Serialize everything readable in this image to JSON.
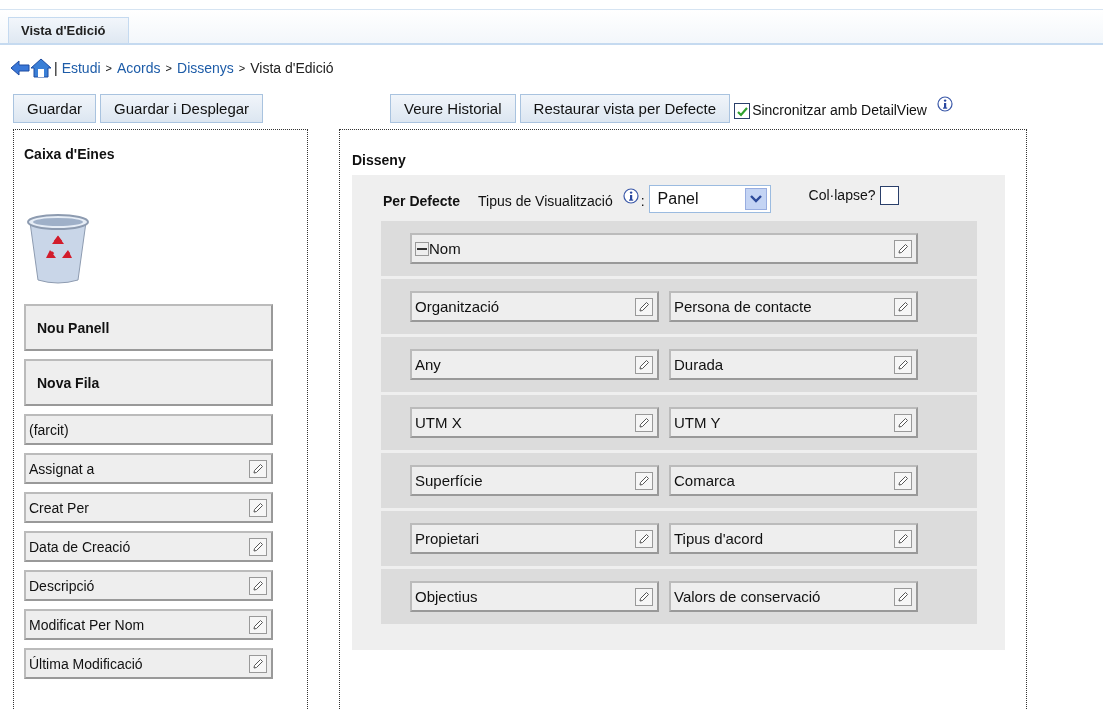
{
  "tab": {
    "label": "Vista d'Edició",
    "selected": true
  },
  "breadcrumb": {
    "divider": "|",
    "links": [
      "Estudi",
      "Acords",
      "Dissenys"
    ],
    "separator": ">",
    "current": "Vista d'Edició"
  },
  "left_buttons": [
    "Guardar",
    "Guardar i Desplegar"
  ],
  "right_buttons": [
    "Veure Historial",
    "Restaurar vista per Defecte"
  ],
  "sync": {
    "label": "Sincronitzar amb DetailView",
    "checked": true
  },
  "toolbox": {
    "title": "Caixa d'Eines",
    "items": [
      {
        "kind": "panel",
        "label": "Nou Panell"
      },
      {
        "kind": "row",
        "label": "Nova Fila"
      },
      {
        "kind": "filler",
        "label": "(farcit)"
      },
      {
        "kind": "field",
        "label": "Assignat a"
      },
      {
        "kind": "field",
        "label": "Creat Per"
      },
      {
        "kind": "field",
        "label": "Data de Creació"
      },
      {
        "kind": "field",
        "label": "Descripció"
      },
      {
        "kind": "field",
        "label": "Modificat Per Nom"
      },
      {
        "kind": "field",
        "label": "Última Modificació"
      }
    ]
  },
  "design": {
    "title": "Disseny",
    "panel_label": "Per Defecte",
    "view_type_label": "Tipus de Visualització",
    "view_type_suffix": ":",
    "view_type": "Panel",
    "collapse": {
      "label": "Col·lapse?",
      "checked": false
    },
    "rows": [
      {
        "fields": [
          {
            "label": "Nom",
            "kind": "wide"
          }
        ]
      },
      {
        "fields": [
          {
            "label": "Organització",
            "kind": "half"
          },
          {
            "label": "Persona de contacte",
            "kind": "half"
          }
        ]
      },
      {
        "fields": [
          {
            "label": "Any",
            "kind": "half"
          },
          {
            "label": "Durada",
            "kind": "half"
          }
        ]
      },
      {
        "fields": [
          {
            "label": "UTM X",
            "kind": "half"
          },
          {
            "label": "UTM Y",
            "kind": "half"
          }
        ]
      },
      {
        "fields": [
          {
            "label": "Superfície",
            "kind": "half"
          },
          {
            "label": "Comarca",
            "kind": "half"
          }
        ]
      },
      {
        "fields": [
          {
            "label": "Propietari",
            "kind": "half"
          },
          {
            "label": "Tipus d'acord",
            "kind": "half"
          }
        ]
      },
      {
        "fields": [
          {
            "label": "Objectius",
            "kind": "half"
          },
          {
            "label": "Valors de conservació",
            "kind": "half"
          }
        ]
      }
    ]
  }
}
